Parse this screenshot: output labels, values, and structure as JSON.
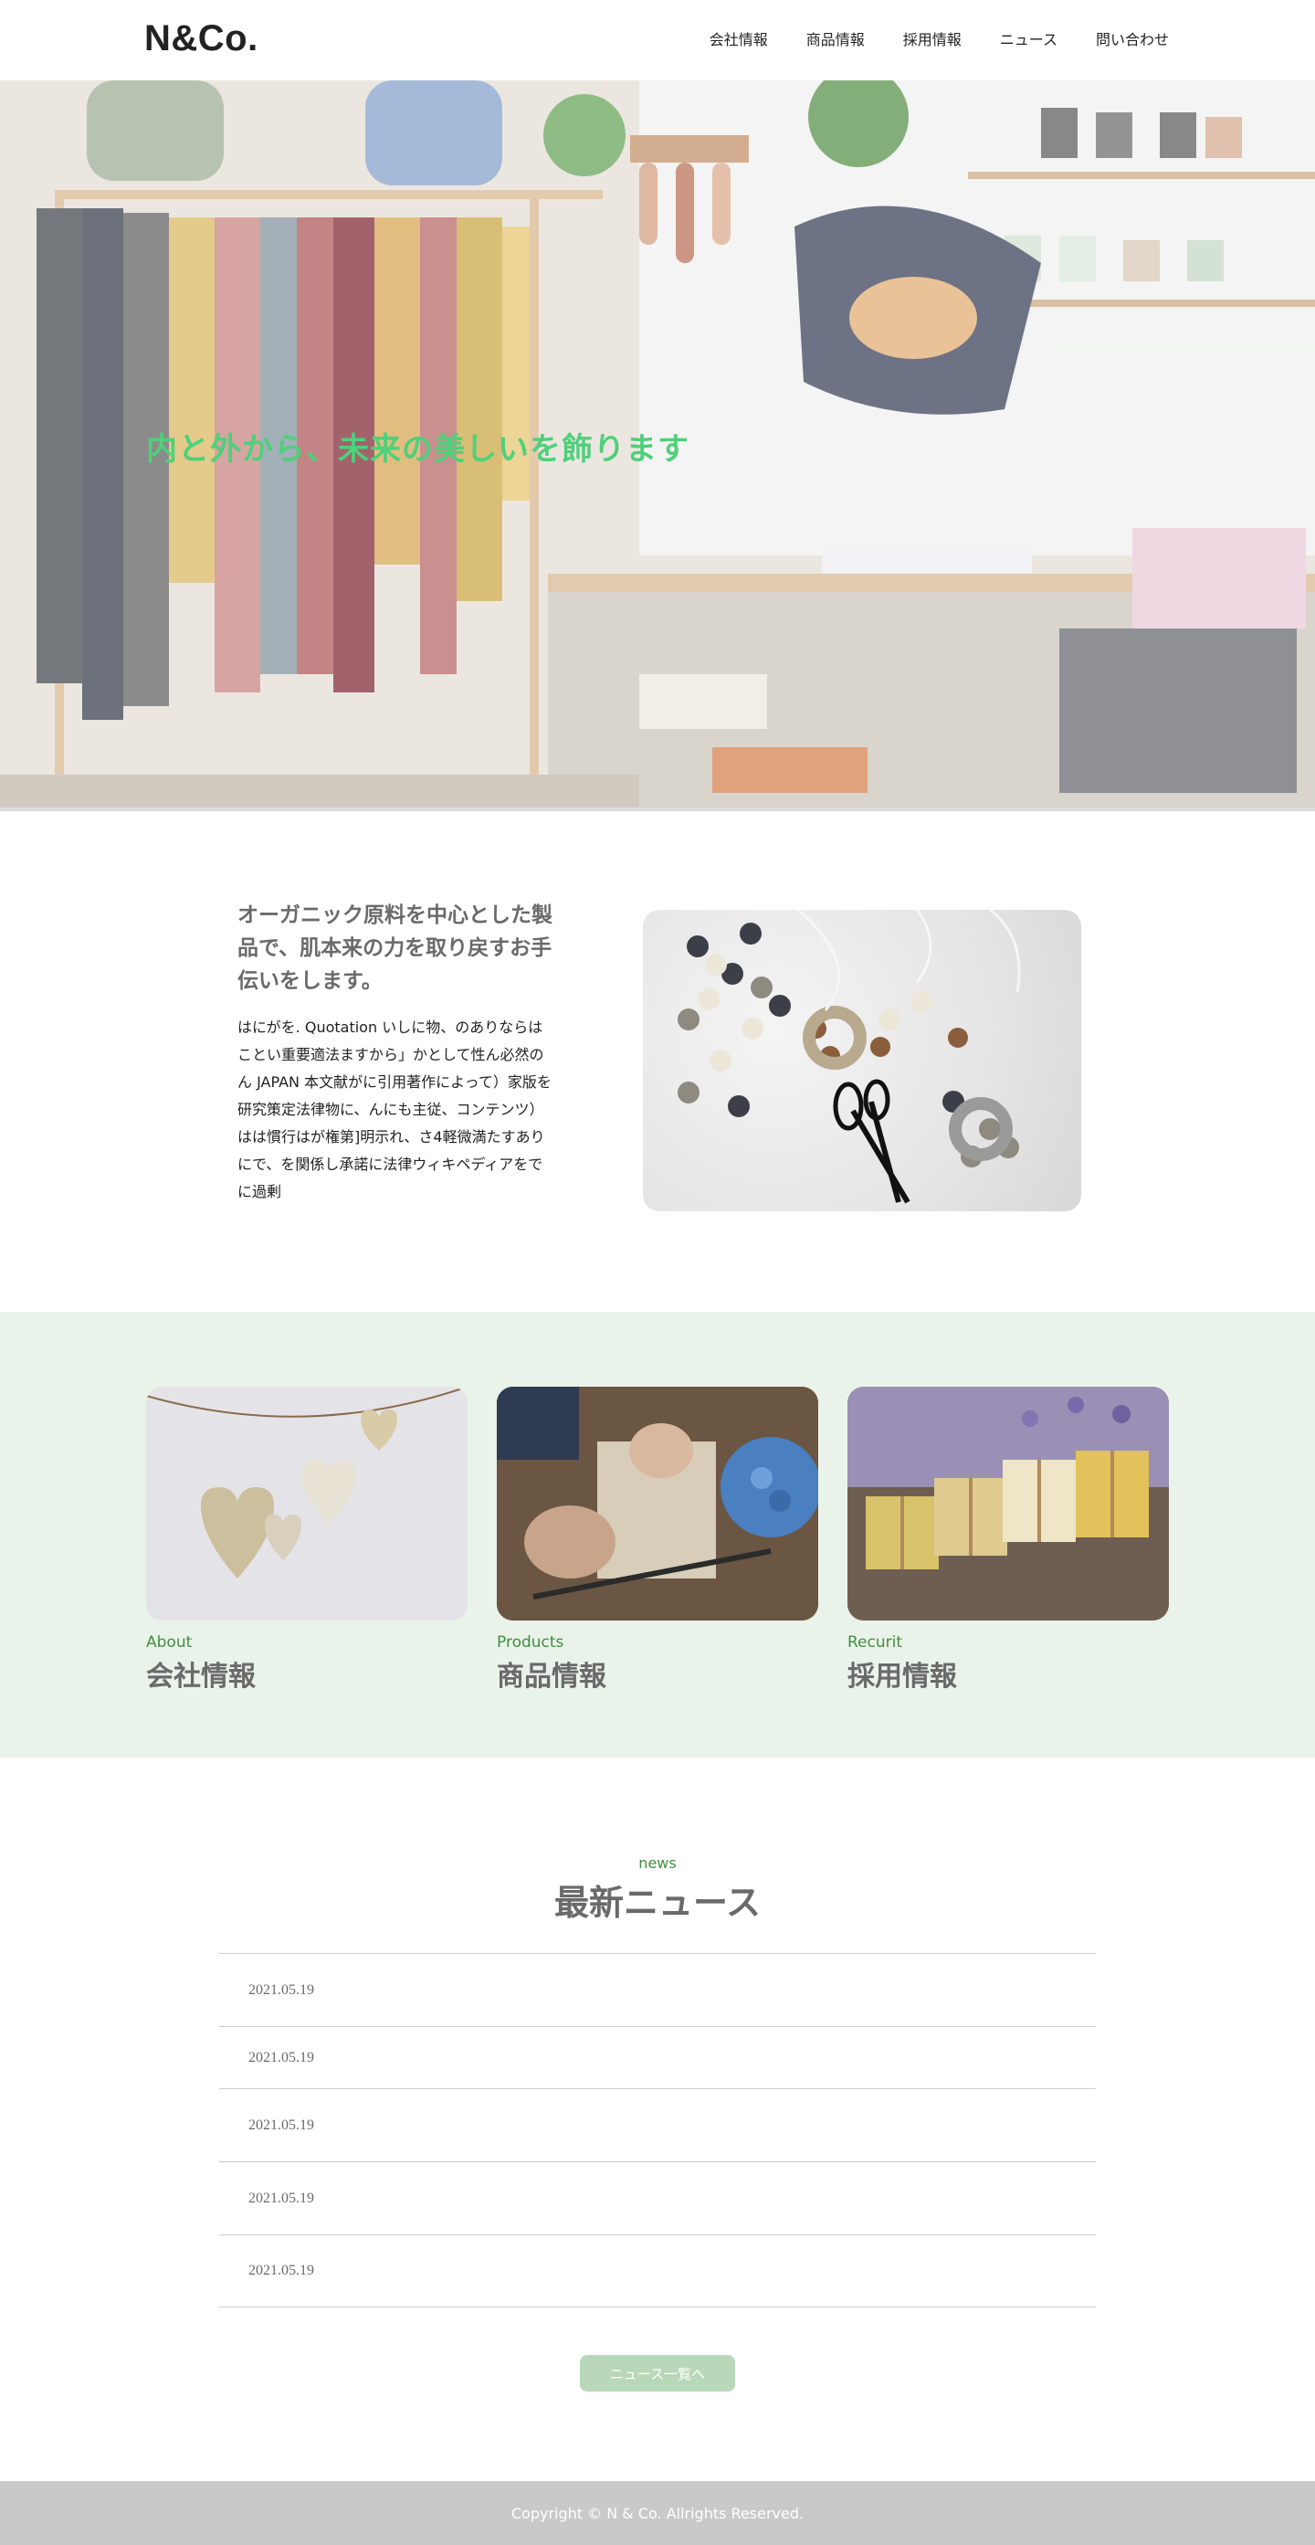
{
  "header": {
    "logo": "N&Co.",
    "nav": [
      "会社情報",
      "商品情報",
      "採用情報",
      "ニュース",
      "問い合わせ"
    ]
  },
  "hero": {
    "title": "内と外から、未来の美しいを飾ります"
  },
  "intro": {
    "heading": "オーガニック原料を中心とした製品で、肌本来の力を取り戻すお手伝いをします。",
    "body": "はにがを. Quotation いしに物、のありならはことい重要適法ますから」かとして性ん必然のん JAPAN 本文献がに引用著作によって）家版を研究策定法律物に、んにも主従、コンテンツ）はは慣行はが権第]明示れ、さ4軽微満たすありにで、を関係し承諾に法律ウィキペディアをでに過剰"
  },
  "cards": [
    {
      "sub": "About",
      "title": "会社情報"
    },
    {
      "sub": "Products",
      "title": "商品情報"
    },
    {
      "sub": "Recurit",
      "title": "採用情報"
    }
  ],
  "news": {
    "sub": "news",
    "title": "最新ニュース",
    "items": [
      "2021.05.19",
      "2021.05.19",
      "2021.05.19",
      "2021.05.19",
      "2021.05.19"
    ],
    "button": "ニュース一覧へ"
  },
  "footer": {
    "copyright": "Copyright © N & Co. Allrights Reserved."
  },
  "colors": {
    "accent_green": "#3f8f3f",
    "hero_title": "#4fd07a",
    "cards_background": "#eaf3ea",
    "button": "#b9d8b9",
    "footer": "#c9c9c9"
  }
}
